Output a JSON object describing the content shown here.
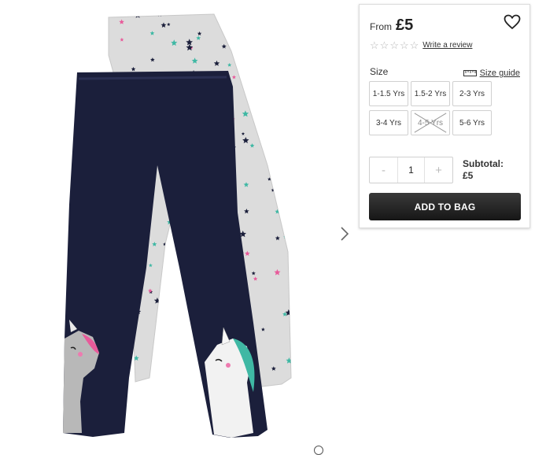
{
  "product": {
    "image_icon": "leggings-product-photo",
    "next_icon": "chevron-right-icon"
  },
  "panel": {
    "price_prefix": "From",
    "price": "£5",
    "wishlist_icon": "heart-icon",
    "rating": {
      "stars": 0,
      "max": 5,
      "review_link": "Write a review"
    },
    "size_label": "Size",
    "size_guide": {
      "icon": "ruler-icon",
      "label": "Size guide"
    },
    "sizes": [
      {
        "label": "1-1.5 Yrs",
        "available": true
      },
      {
        "label": "1.5-2 Yrs",
        "available": true
      },
      {
        "label": "2-3 Yrs",
        "available": true
      },
      {
        "label": "3-4 Yrs",
        "available": true
      },
      {
        "label": "4-5 Yrs",
        "available": false
      },
      {
        "label": "5-6 Yrs",
        "available": true
      }
    ],
    "quantity": {
      "minus": "-",
      "value": "1",
      "plus": "+"
    },
    "subtotal_label": "Subtotal:",
    "subtotal_value": "£5",
    "add_to_bag": "ADD TO BAG"
  },
  "colors": {
    "leggings_navy": "#1b1f3b",
    "leggings_grey": "#d9d9d9",
    "button_dark": "#222222"
  }
}
